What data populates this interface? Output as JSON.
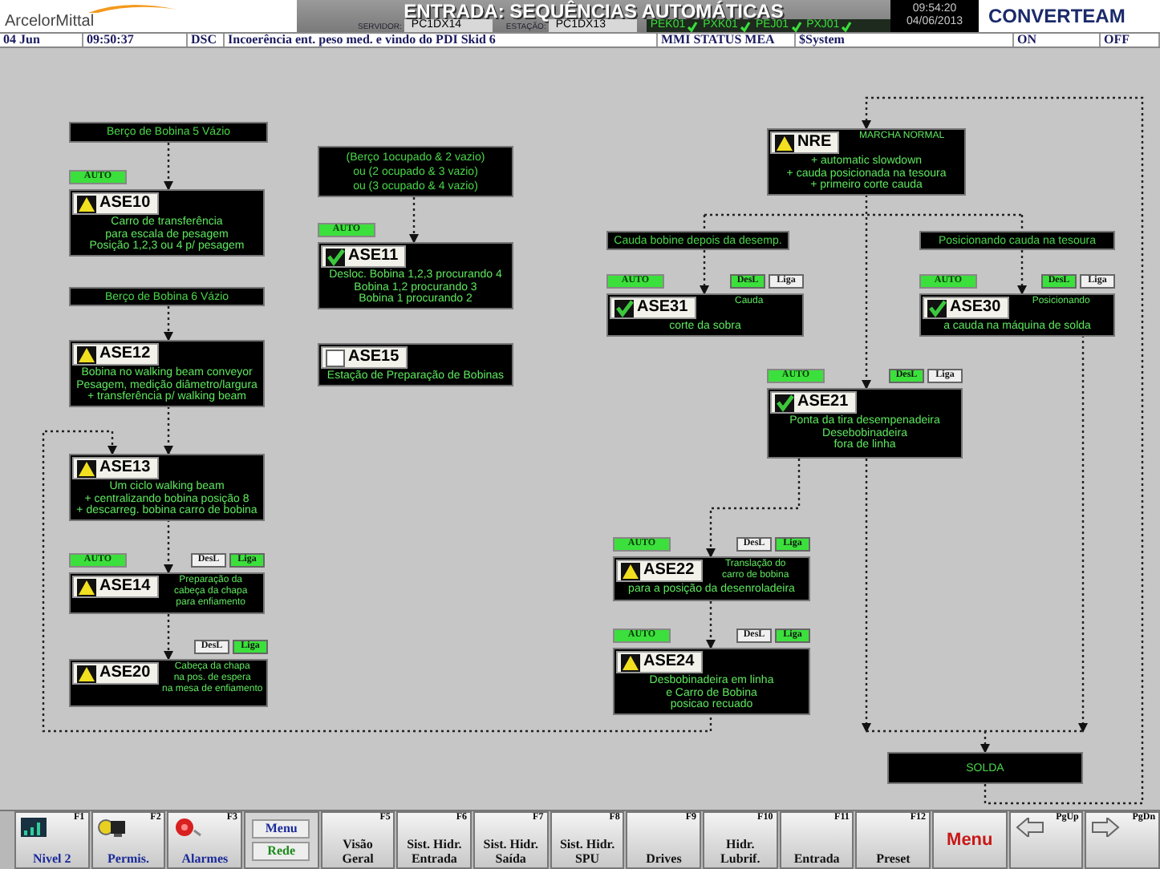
{
  "header": {
    "logo": "ArcelorMittal",
    "title": "ENTRADA: SEQUÊNCIAS AUTOMÁTICAS",
    "server_label": "SERVIDOR:",
    "server": "PC1DX14",
    "station_label": "ESTAÇÃO:",
    "station": "PC1DX13",
    "links": [
      {
        "label": "PEK01",
        "ok": true
      },
      {
        "label": "PXK01",
        "ok": true
      },
      {
        "label": "PEJ01",
        "ok": true
      },
      {
        "label": "PXJ01",
        "ok": true
      }
    ],
    "time": "09:54:20",
    "date": "04/06/2013",
    "brand": "CONVERTEAM"
  },
  "alarm_line": {
    "date": "04 Jun",
    "time": "09:50:37",
    "type": "DSC",
    "message": "Incoerência ent. peso med. e vindo do PDI Skid 6",
    "source": "MMI STATUS MEA",
    "user": "$System",
    "state_on": "ON",
    "state_off": "OFF"
  },
  "labels": [
    "Berço de Bobina 5 Vázio",
    "Berço de Bobina 6 Vázio",
    "(Berço 1ocupado & 2 vazio)\nou (2 ocupado  & 3 vazio)\nou (3 ocupado & 4 vazio)",
    "Cauda bobine depois da desemp.",
    "Posicionando cauda na tesoura",
    "SOLDA"
  ],
  "steps": [
    {
      "id": "ASE10",
      "checked": false,
      "alarm": true,
      "auto": "AUTO",
      "text": "Carro de transferência\npara escala de pesagem\nPosição 1,2,3 ou 4 p/ pesagem"
    },
    {
      "id": "ASE12",
      "checked": false,
      "alarm": true,
      "text": "Bobina no walking beam conveyor\nPesagem, medição diâmetro/largura\n+ transferência p/ walking beam"
    },
    {
      "id": "ASE13",
      "checked": false,
      "alarm": true,
      "text": "Um ciclo walking beam\n+ centralizando bobina posição 8\n+ descarreg. bobina carro de bobina"
    },
    {
      "id": "ASE14",
      "checked": false,
      "alarm": true,
      "auto": "AUTO",
      "side_text": "Preparação da\ncabeça da chapa\npara enfiamento",
      "buttons": [
        {
          "label": "DesL",
          "selected": false
        },
        {
          "label": "Liga",
          "selected": true
        }
      ]
    },
    {
      "id": "ASE20",
      "checked": false,
      "alarm": true,
      "side_text": "Cabeça da chapa\nna pos. de espera\nna mesa de enfiamento",
      "buttons": [
        {
          "label": "DesL",
          "selected": false
        },
        {
          "label": "Liga",
          "selected": true
        }
      ]
    },
    {
      "id": "ASE11",
      "checked": true,
      "alarm": false,
      "auto": "AUTO",
      "text": "Desloc. Bobina 1,2,3 procurando 4\nBobina 1,2 procurando 3\nBobina 1 procurando 2"
    },
    {
      "id": "ASE15",
      "checked": false,
      "alarm": false,
      "text": "Estação de Preparação de Bobinas"
    },
    {
      "id": "NRE",
      "checked": false,
      "alarm": true,
      "side_text": "MARCHA NORMAL",
      "text": "+ automatic slowdown\n+ cauda posicionada na tesoura\n+ primeiro corte cauda"
    },
    {
      "id": "ASE31",
      "checked": true,
      "alarm": false,
      "auto": "AUTO",
      "side_text": "Cauda",
      "text": "corte da sobra",
      "buttons": [
        {
          "label": "DesL",
          "selected": true
        },
        {
          "label": "Liga",
          "selected": false
        }
      ]
    },
    {
      "id": "ASE30",
      "checked": true,
      "alarm": false,
      "auto": "AUTO",
      "side_text": "Posicionando",
      "text": "a cauda na máquina de solda",
      "buttons": [
        {
          "label": "DesL",
          "selected": true
        },
        {
          "label": "Liga",
          "selected": false
        }
      ]
    },
    {
      "id": "ASE21",
      "checked": true,
      "alarm": false,
      "auto": "AUTO",
      "text": "Ponta da tira desempenadeira\nDesebobinadeira\nfora de linha",
      "buttons": [
        {
          "label": "DesL",
          "selected": true
        },
        {
          "label": "Liga",
          "selected": false
        }
      ]
    },
    {
      "id": "ASE22",
      "checked": false,
      "alarm": true,
      "auto": "AUTO",
      "side_text": "Translação do\ncarro de bobina",
      "text": "para a posição da desenroladeira",
      "buttons": [
        {
          "label": "DesL",
          "selected": false
        },
        {
          "label": "Liga",
          "selected": true
        }
      ]
    },
    {
      "id": "ASE24",
      "checked": false,
      "alarm": true,
      "auto": "AUTO",
      "text": "Desbobinadeira em linha\ne Carro de Bobina\nposicao recuado",
      "buttons": [
        {
          "label": "DesL",
          "selected": false
        },
        {
          "label": "Liga",
          "selected": true
        }
      ]
    }
  ],
  "function_keys": [
    {
      "kind": "icon",
      "key": "F1",
      "label": "Nivel 2"
    },
    {
      "kind": "icon",
      "key": "F2",
      "label": "Permis."
    },
    {
      "kind": "icon",
      "key": "F3",
      "label": "Alarmes"
    },
    {
      "kind": "pair",
      "labels": [
        "Menu",
        "Rede"
      ]
    },
    {
      "kind": "text",
      "key": "F5",
      "label": "Visão\nGeral"
    },
    {
      "kind": "text",
      "key": "F6",
      "label": "Sist. Hidr.\nEntrada"
    },
    {
      "kind": "text",
      "key": "F7",
      "label": "Sist. Hidr.\nSaída"
    },
    {
      "kind": "text",
      "key": "F8",
      "label": "Sist. Hidr.\nSPU"
    },
    {
      "kind": "text",
      "key": "F9",
      "label": "Drives"
    },
    {
      "kind": "text",
      "key": "F10",
      "label": "Hidr.\nLubrif."
    },
    {
      "kind": "text",
      "key": "F11",
      "label": "Entrada"
    },
    {
      "kind": "text",
      "key": "F12",
      "label": "Preset"
    },
    {
      "kind": "menu",
      "label": "Menu"
    },
    {
      "kind": "arrow",
      "key": "PgUp"
    },
    {
      "kind": "arrow",
      "key": "PgDn"
    }
  ]
}
